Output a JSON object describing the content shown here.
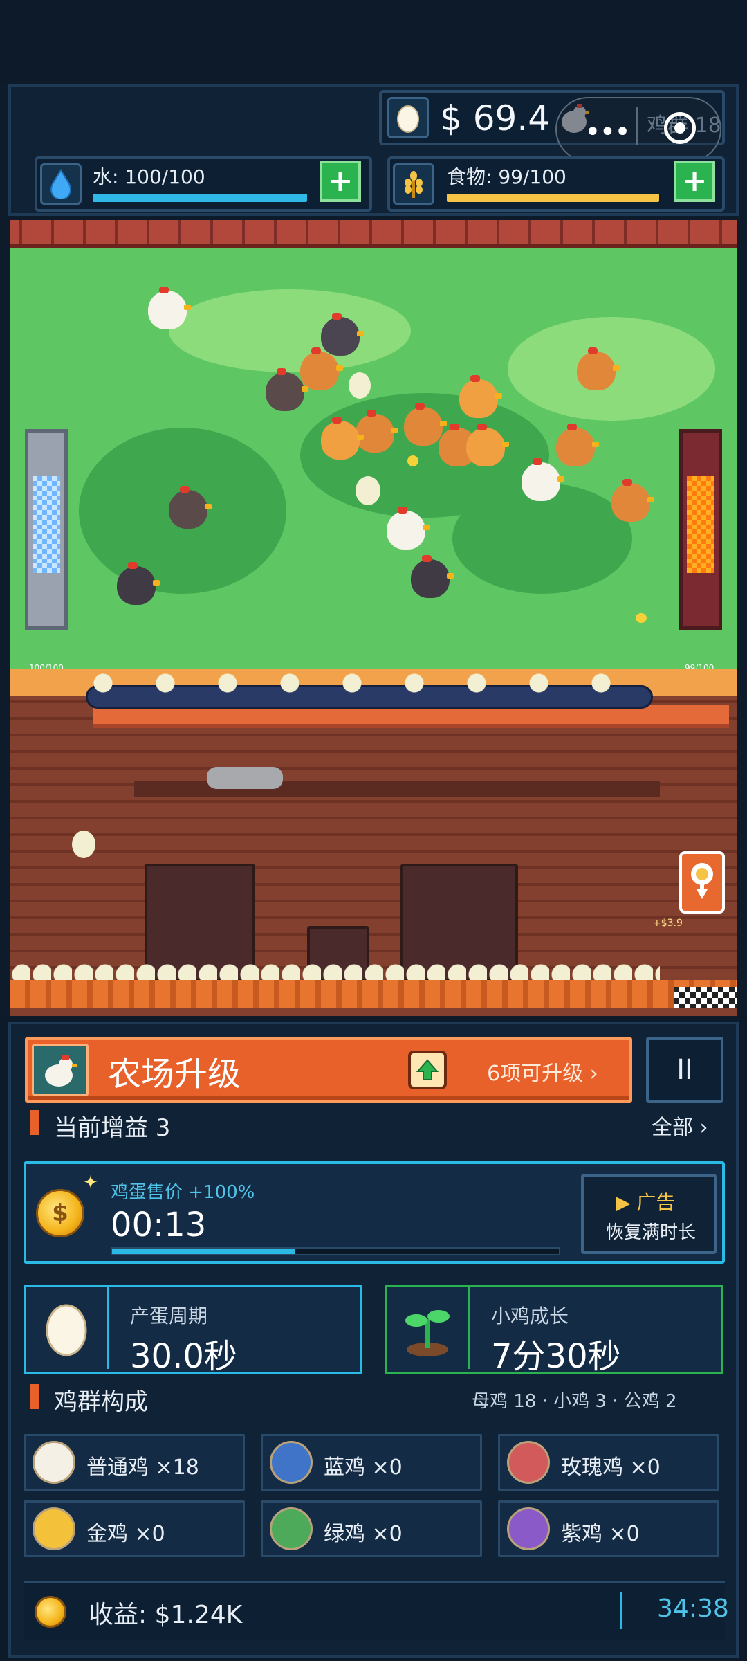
{
  "hud": {
    "money": "$ 69.4",
    "chicken_count": "鸡群 18",
    "water": {
      "label": "水: 100/100",
      "fill": 1.0,
      "color": "#30b9e6"
    },
    "food": {
      "label": "食物: 99/100",
      "fill": 0.99,
      "color": "#f6c445"
    },
    "plus": "+"
  },
  "scene": {
    "water_tank_label": "100/100",
    "food_tank_label": "99/100",
    "gain_popup": "+$3.9"
  },
  "upgrade": {
    "title": "农场升级",
    "count": "6项可升级 ›",
    "pause": "II"
  },
  "boosts": {
    "title": "当前增益 3",
    "link": "全部 ›",
    "egg_price": {
      "label": "鸡蛋售价 +100%",
      "timer": "00:13",
      "progress": 0.41
    },
    "ad": {
      "title": "▶ 广告",
      "subtitle": "恢复满时长"
    }
  },
  "stats": {
    "egg_cycle": {
      "label": "产蛋周期",
      "value": "30.0秒"
    },
    "chick_growth": {
      "label": "小鸡成长",
      "value": "7分30秒"
    }
  },
  "flock": {
    "title": "鸡群构成",
    "summary": "母鸡 18  ·  小鸡 3  ·  公鸡 2",
    "types": [
      {
        "label": "普通鸡 ×18",
        "color": "#f5f0e6"
      },
      {
        "label": "蓝鸡 ×0",
        "color": "#3f74c8"
      },
      {
        "label": "玫瑰鸡 ×0",
        "color": "#d25a5a"
      },
      {
        "label": "金鸡 ×0",
        "color": "#f4c23a"
      },
      {
        "label": "绿鸡 ×0",
        "color": "#4caa5a"
      },
      {
        "label": "紫鸡 ×0",
        "color": "#8a5ac8"
      }
    ]
  },
  "income": {
    "label": "收益: $1.24K",
    "time": "34:38"
  },
  "colors": {
    "accent_orange": "#e8602a",
    "accent_cyan": "#2bb9e6",
    "accent_green": "#2bb34f",
    "panel": "#0f2236"
  }
}
